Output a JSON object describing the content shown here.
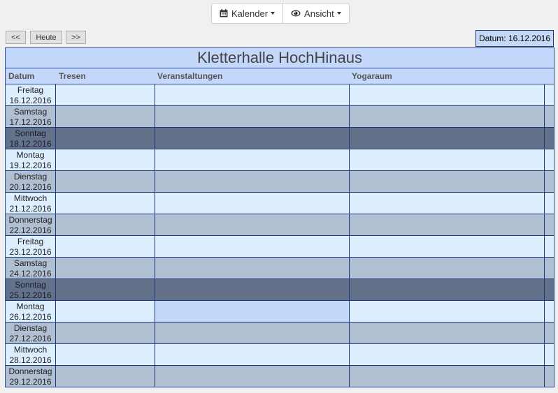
{
  "toolbar": {
    "calendar_label": "Kalender",
    "view_label": "Ansicht"
  },
  "nav": {
    "prev_label": "<<",
    "today_label": "Heute",
    "next_label": ">>",
    "date_display": "Datum: 16.12.2016"
  },
  "calendar": {
    "title": "Kletterhalle HochHinaus",
    "columns": [
      "Datum",
      "Tresen",
      "Veranstaltungen",
      "Yogaraum"
    ],
    "rows": [
      {
        "day": "Freitag",
        "date": "16.12.2016",
        "type": "weekday"
      },
      {
        "day": "Samstag",
        "date": "17.12.2016",
        "type": "saturday"
      },
      {
        "day": "Sonntag",
        "date": "18.12.2016",
        "type": "sunday"
      },
      {
        "day": "Montag",
        "date": "19.12.2016",
        "type": "weekday"
      },
      {
        "day": "Dienstag",
        "date": "20.12.2016",
        "type": "saturday"
      },
      {
        "day": "Mittwoch",
        "date": "21.12.2016",
        "type": "weekday"
      },
      {
        "day": "Donnerstag",
        "date": "22.12.2016",
        "type": "saturday"
      },
      {
        "day": "Freitag",
        "date": "23.12.2016",
        "type": "weekday"
      },
      {
        "day": "Samstag",
        "date": "24.12.2016",
        "type": "saturday"
      },
      {
        "day": "Sonntag",
        "date": "25.12.2016",
        "type": "sunday"
      },
      {
        "day": "Montag",
        "date": "26.12.2016",
        "type": "weekday",
        "highlight_column": 2
      },
      {
        "day": "Dienstag",
        "date": "27.12.2016",
        "type": "saturday"
      },
      {
        "day": "Mittwoch",
        "date": "28.12.2016",
        "type": "weekday"
      },
      {
        "day": "Donnerstag",
        "date": "29.12.2016",
        "type": "saturday"
      }
    ]
  },
  "icons": {
    "calendar": "calendar-icon",
    "view": "eye-icon"
  }
}
